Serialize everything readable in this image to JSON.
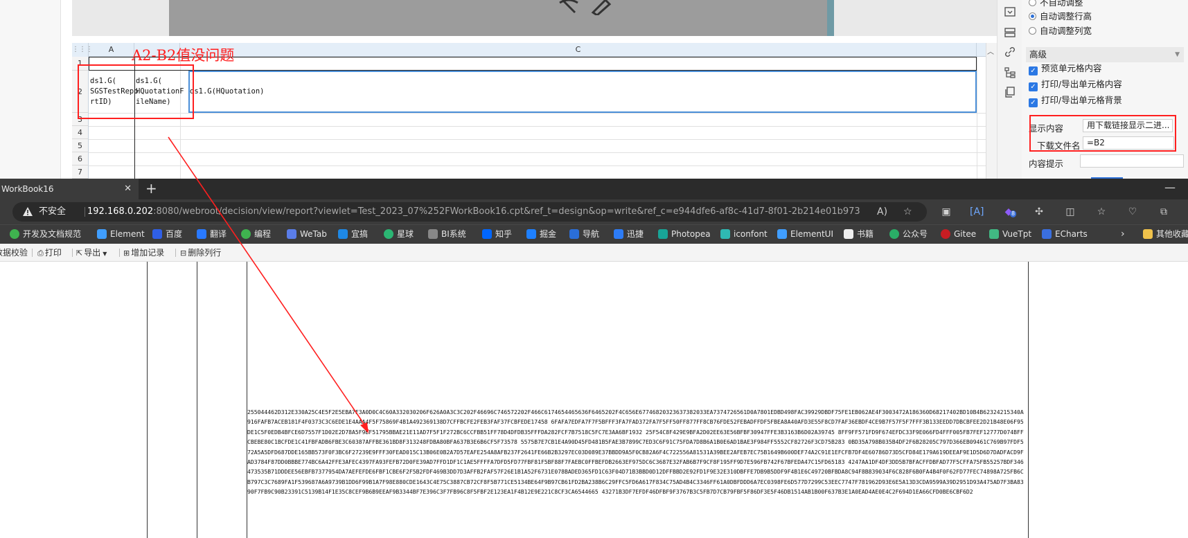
{
  "designer": {
    "columns": [
      "A",
      "C"
    ],
    "rows": [
      "1",
      "2",
      "3",
      "4",
      "5",
      "6",
      "7"
    ],
    "cells": {
      "a2": "ds1.G(\nSGSTestRepo\nrtID)",
      "b2": "ds1.G(\nHQuotationF\nileName)",
      "c2": "ds1.G(HQuotation)"
    },
    "annotation": "A2-B2值没问题"
  },
  "properties": {
    "radio_not_auto": "不自动调整",
    "radio_auto_row": "自动调整行高",
    "radio_auto_col": "自动调整列宽",
    "advanced": "高级",
    "check_preview": "预览单元格内容",
    "check_print_content": "打印/导出单元格内容",
    "check_print_bg": "打印/导出单元格背景",
    "display_label": "显示内容",
    "display_value": "用下载链接显示二进...",
    "filename_label": "下载文件名",
    "filename_value": "=B2",
    "tooltip_label": "内容提示",
    "tooltip_value": ""
  },
  "browser": {
    "tab_title": "WorkBook16",
    "not_secure": "不安全",
    "url_host": "192.168.0.202",
    "url_path": ":8080/webroot/decision/view/report?viewlet=Test_2023_07%252FWorkBook16.cpt&ref_t=design&op=write&ref_c=e944dfe6-af8c-41d7-8f01-2b214e01b973",
    "extension_badge": "8",
    "bookmarks": [
      "开发及文档规范",
      "Element",
      "百度",
      "翻译",
      "编程",
      "WeTab",
      "宜搞",
      "星球",
      "BI系统",
      "知乎",
      "掘金",
      "导航",
      "迅捷",
      "Photopea",
      "iconfont",
      "ElementUI",
      "书籍",
      "公众号",
      "Gitee",
      "VueTpt",
      "ECharts",
      "其他收藏"
    ]
  },
  "toolbar": {
    "validate": "数据校验",
    "print": "打印",
    "export": "导出",
    "add_record": "增加记录",
    "delete_row": "删除列行"
  },
  "report": {
    "hex_text": "255044462D312E330A25C4E5F2E5EBA7F3A0D0C4C60A332030206F626A0A3C3C202F46696C746572202F466C6174654465636F6465202F4C656E67746820323637382033EA7374726561D0A7801EDBD498FAC39929DBDF75FE1EB062AE4F3003472A186360D68217402BD10B4B62324215340A916FAFB7ACEB181F4F0373C3C6EDE1E4AAA4F5F75869F4B1A492369138D7CFFBCFE2FEB3FAF37FCBFEDE17458 6FAFA7EDFA7F7F5BFFF3FA7FAD372FA7F5FF50FF877FF8CB76FDE52FEBADFFDF5FBEA8A40AFD3E55F8CD7FAF36EBDF4CE9B7F57F5F7FFF3B133EEDD7DBCBFEE2D21B48E06F95DE1C5F0EDB4BFCE6D7557F1D02E2D78A5F9BF51795BBAE21E11AD7F5F1F272BC6CCFBB51FF78D4DFDB35FFFDA282FCF7B7518C5FC7E3AA6BF1932 25F54C8F429E9BFA2D02EE63E56BFBF30947FFE3B3163B6D02A39745 8FF9FF571FD9F674EFDC33F9E066FD4FFF005FB7FEF12777D074BFFCBEBE80C1BCFDE1C41FBFADB6FBE3C60387AFFBE361BD8F313248FDBA80BFA637B3E6B6CF5F73578 5575B7E7CB1E4A90D45FD481B5FAE3B7899C7ED3C6F91C75FDA7D8B6A1B0E6AD1BAE3F984FF5552CF82726F3CD75B283 0BD35A798B035B4DF2F6B28205C797D366EB09461C769B97FDF572A5A5DFD687DDE165BB573F0F3BC6F27239E9FFF30FEAD015C13B06E0B2A7D57EAFE254A8AFB237F2641FE66B2B3297EC03D089E37BBDD9A5F0CB82A6F4C722556A81531A39BEE2AFEB7EC75B1649B600DEF74A2C91E1EFCFB7DF4E60786D73D5CFD84E179A619DEEAF9E1D5D6D7DADFACD9FAD3784F87DD0BBBE774BC6A42FFE3AFEC4397FA93FEFB72D0FE39AD7FFD1DF1C1AE5FFFFA7DFD5FD77FBF81F5BF88F7FAEBC0FFBEFDB2663EF975DC6C3687E32FAB6B7F9CF8F195FF9D7E596FB742F67BFEDA47C15FD65183 4247AA1DF4DF3DD5B7BFACFFDBFAD77F5CFFA75FB55257BDF346473535B71DDDEE56EBFB7377954DA7AEFEFDE6FBF1CBE6F2F5B2FDF469B3DD7D3AFFB2FAF57F26E1B1A52F6731E078BADED365FD1C63F04D71B3BBD0D12DFFBBD2E92FD1F9E32E310DBFFE7DB9B5DDF9F4B1E6C49720BFBDA8C94F8B839034F6C828F6B0FA4B4F0F62FD77FEC74898A725FB6CB797C3C7689FA1F539687A6A9739B1DD6F99B1A7F98E880CDE1643C4E75C3887CB72CF8F5B771CE5134BE64F9B97CB61FD2BA238B6C29FFC5FD6A617F834C75AD4B4C3346FF61A0DBFDDD6A7EC0398FE6D577D7299C53EEC7747F781962D93E6E5A13D3CDA9599A39D2951D93A475AD7F3BA8390F7FB9C90B23391C5139B14F1E35C8CEF9B6B9EEAF9B3344BF7E396C3F7FB96C8F5FBF2E123EA1F4B12E9E221C8CF3CA6544665 43271B3DF7EFDF46DFBF9F3767B3C5FB7D7CB79FBF5F86DF3E5F46DB1514AB1B00F637B3E1A0EAD4AE0E4C2F694D1EA66CFD0BE6CBF6D2"
  }
}
